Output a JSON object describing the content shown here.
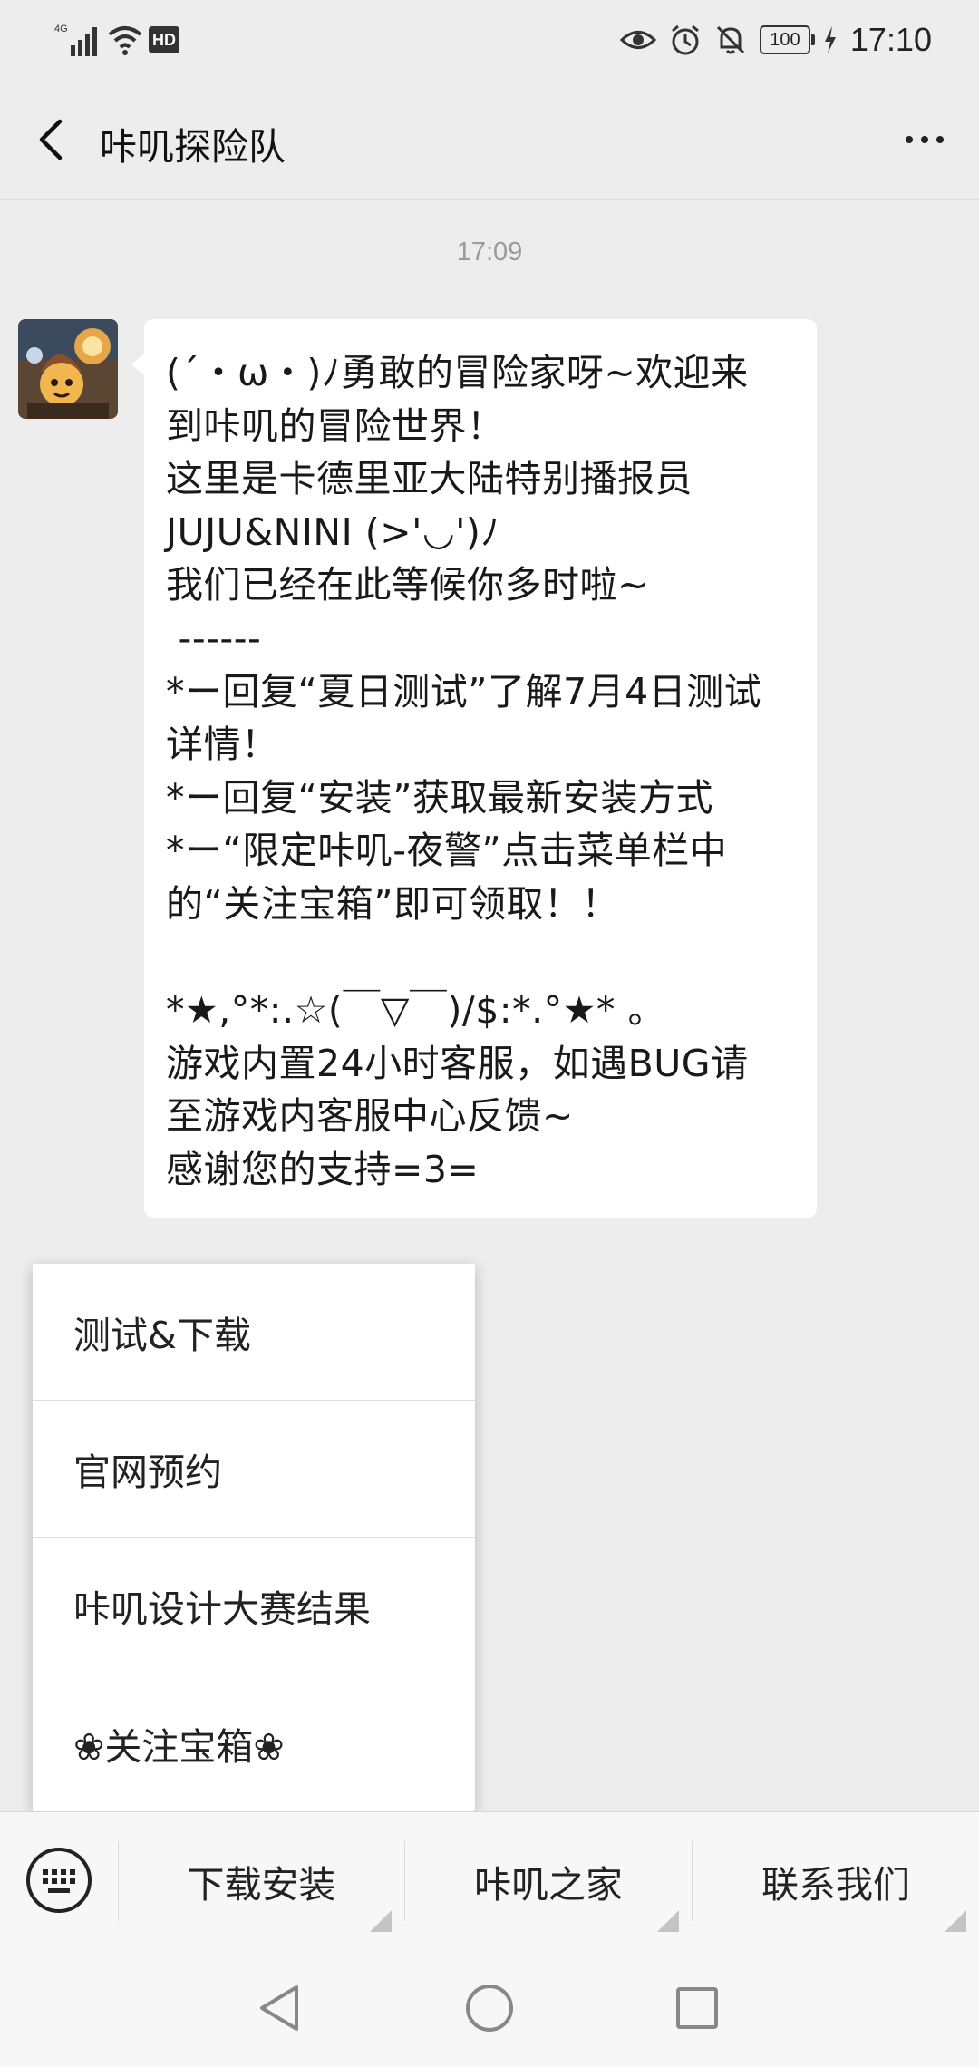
{
  "status_bar": {
    "network": "4G",
    "hd": "HD",
    "battery": "100",
    "time": "17:10"
  },
  "header": {
    "title": "咔叽探险队"
  },
  "chat": {
    "timestamp": "17:09",
    "message_lines": [
      "(´・ω・)ﾉ勇敢的冒险家呀~欢迎来",
      "到咔叽的冒险世界！",
      "这里是卡德里亚大陆特别播报员",
      "JUJU&NINI (>'◡')ﾉ",
      "我们已经在此等候你多时啦~",
      " ------",
      "*ー回复“夏日测试”了解7月4日测试",
      "详情！",
      "*ー回复“安装”获取最新安装方式",
      "*ー“限定咔叽-夜警”点击菜单栏中",
      "的“关注宝箱”即可领取！！",
      "",
      "*★,°*:.☆(￣▽￣)/$:*.°★* 。",
      "游戏内置24小时客服，如遇BUG请",
      "至游戏内客服中心反馈~",
      "感谢您的支持=3="
    ]
  },
  "popup_menu": {
    "items": [
      "测试&下载",
      "官网预约",
      "咔叽设计大赛结果",
      "❀关注宝箱❀"
    ]
  },
  "menu_bar": {
    "tabs": [
      "下载安装",
      "咔叽之家",
      "联系我们"
    ]
  },
  "colors": {
    "background": "#ededed",
    "bubble": "#ffffff",
    "menubar": "#f7f7f7"
  },
  "icons": {
    "back": "chevron-left-icon",
    "more": "more-dots-icon",
    "keyboard": "keyboard-icon",
    "nav_back": "triangle-back-icon",
    "nav_home": "circle-home-icon",
    "nav_recents": "square-recents-icon"
  }
}
